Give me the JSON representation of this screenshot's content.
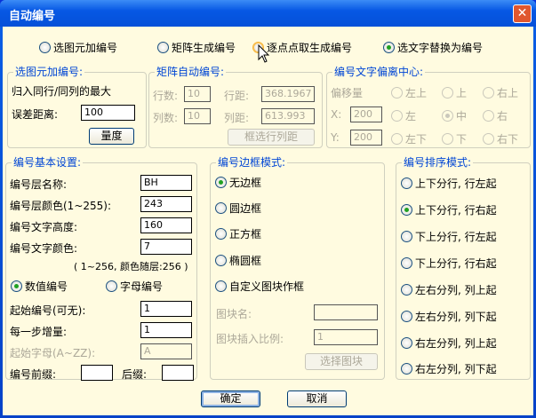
{
  "window": {
    "title": "自动编号",
    "close": "✕"
  },
  "mode": {
    "options": [
      "选图元加编号",
      "矩阵生成编号",
      "逐点点取生成编号",
      "选文字替换为编号"
    ],
    "selected": "选文字替换为编号"
  },
  "select_group": {
    "title": "选图元加编号:",
    "line1": "归入同行/同列的最大",
    "tol_label": "误差距离:",
    "tol_value": "100",
    "measure_btn": "量度"
  },
  "matrix_group": {
    "title": "矩阵自动编号:",
    "rows_label": "行数:",
    "rows_value": "10",
    "row_dist_label": "行距:",
    "row_dist_value": "368.1967",
    "cols_label": "列数:",
    "cols_value": "10",
    "col_dist_label": "列距:",
    "col_dist_value": "613.993",
    "pick_btn": "框选行列距"
  },
  "offset_group": {
    "title": "编号文字偏离中心:",
    "offset_label": "偏移量",
    "x_label": "X:",
    "x_value": "200",
    "y_label": "Y:",
    "y_value": "200",
    "positions": [
      "左上",
      "上",
      "右上",
      "左",
      "中",
      "右",
      "左下",
      "下",
      "右下"
    ],
    "selected": "中"
  },
  "basic_group": {
    "title": "编号基本设置:",
    "layer_name_label": "编号层名称:",
    "layer_name_value": "BH",
    "layer_color_label": "编号层颜色(1~255):",
    "layer_color_value": "243",
    "text_height_label": "编号文字高度:",
    "text_height_value": "160",
    "text_color_label": "编号文字颜色:",
    "text_color_value": "7",
    "color_hint": "( 1~256, 颜色随层:256 )",
    "numeric_label": "数值编号",
    "alpha_label": "字母编号",
    "start_label": "起始编号(可无):",
    "start_value": "1",
    "step_label": "每一步增量:",
    "step_value": "1",
    "start_letter_label": "起始字母(A~ZZ):",
    "start_letter_value": "A",
    "prefix_label": "编号前缀:",
    "prefix_value": "",
    "suffix_label": "后缀:",
    "suffix_value": ""
  },
  "frame_group": {
    "title": "编号边框模式:",
    "options": [
      "无边框",
      "圆边框",
      "正方框",
      "椭圆框",
      "自定义图块作框"
    ],
    "selected": "无边框",
    "block_name_label": "图块名:",
    "block_name_value": "",
    "block_scale_label": "图块插入比例:",
    "block_scale_value": "1",
    "select_block_btn": "选择图块"
  },
  "order_group": {
    "title": "编号排序模式:",
    "options": [
      "上下分行, 行左起",
      "上下分行, 行右起",
      "下上分行, 行左起",
      "下上分行, 行右起",
      "左右分列, 列上起",
      "左右分列, 列下起",
      "右左分列, 列上起",
      "右左分列, 列下起"
    ],
    "selected": "上下分行, 行右起"
  },
  "footer": {
    "ok": "确定",
    "cancel": "取消"
  }
}
